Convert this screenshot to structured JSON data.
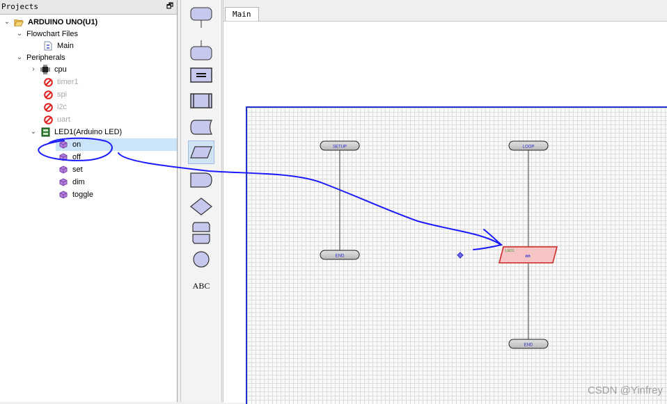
{
  "projects_panel": {
    "title": "Projects",
    "restore_icon": "restore-window-icon",
    "tree": {
      "root": "ARDUINO UNO(U1)",
      "flowchart_files": "Flowchart Files",
      "main": "Main",
      "peripherals": "Peripherals",
      "cpu": "cpu",
      "timer1": "timer1",
      "spi": "spi",
      "i2c": "i2c",
      "uart": "uart",
      "led1": "LED1(Arduino LED)",
      "methods": [
        "on",
        "off",
        "set",
        "dim",
        "toggle"
      ]
    }
  },
  "tools": {
    "text_tool": "ABC"
  },
  "editor": {
    "tab": "Main",
    "flow": {
      "setup": "SETUP",
      "end1": "END",
      "loop": "LOOP",
      "led_block_label": "LED1",
      "led_block_method": "on",
      "end2": "END"
    }
  },
  "colors": {
    "accent_blue": "#1a1aff",
    "shape_fill": "#c6c8ee",
    "selected_block_border": "#cc2222",
    "grid_border": "#2233cc"
  },
  "watermark": "CSDN @Yinfrey"
}
